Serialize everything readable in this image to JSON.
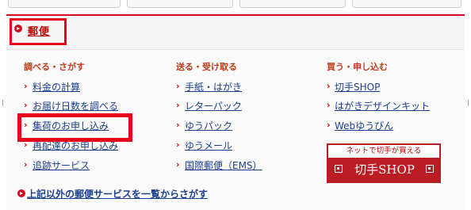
{
  "section": {
    "title": "郵便"
  },
  "columns": [
    {
      "heading": "調べる・さがす",
      "links": [
        "料金の計算",
        "お届け日数を調べる",
        "集荷のお申し込み",
        "再配達のお申し込み",
        "追跡サービス"
      ]
    },
    {
      "heading": "送る・受け取る",
      "links": [
        "手紙・はがき",
        "レターパック",
        "ゆうパック",
        "ゆうメール",
        "国際郵便（EMS）"
      ]
    },
    {
      "heading": "買う・申し込む",
      "links": [
        "切手SHOP",
        "はがきデザインキット",
        "Webゆうびん"
      ]
    }
  ],
  "shop_banner": {
    "tagline": "ネットで切手が買える",
    "name": "切手SHOP"
  },
  "footer_link": "上記以外の郵便サービスを一覧からさがす",
  "colors": {
    "accent_red": "#d40c1e",
    "highlight_red": "#e8001c",
    "link_blue": "#1b3f8f",
    "heading_orange": "#c33a17"
  }
}
